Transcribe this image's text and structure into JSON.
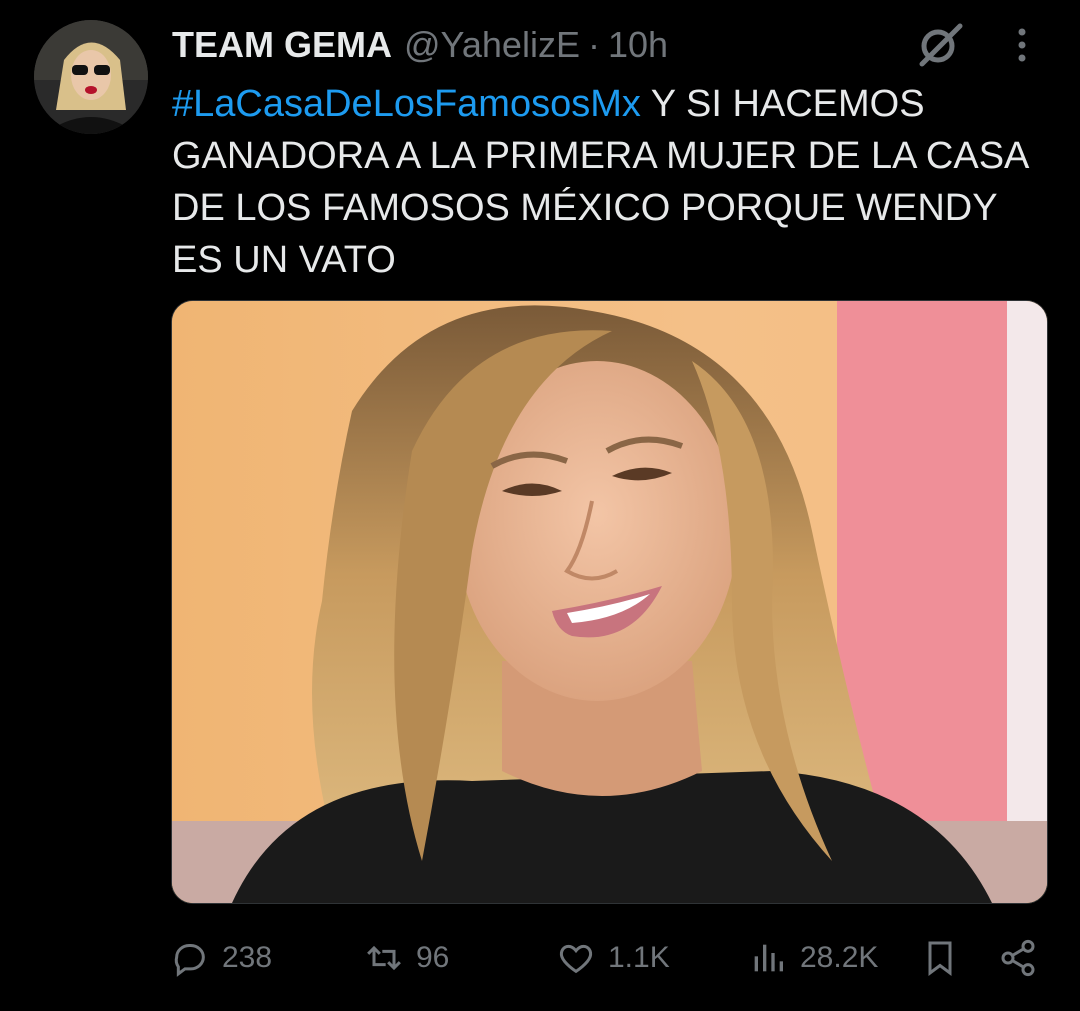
{
  "user": {
    "display_name": "TEAM GEMA",
    "handle": "@YahelizE",
    "separator": "·",
    "timestamp": "10h"
  },
  "header_icons": [
    "grok-icon",
    "more-options-icon"
  ],
  "tweet": {
    "hashtag": "#LaCasaDeLosFamososMx",
    "body": " Y SI HACEMOS GANADORA A LA PRIMERA MUJER DE LA CASA DE LOS FAMOSOS MÉXICO PORQUE WENDY ES UN VATO"
  },
  "media": {
    "icon": "photo"
  },
  "actions": {
    "replies": "238",
    "reposts": "96",
    "likes": "1.1K",
    "views": "28.2K",
    "icons": [
      "reply-icon",
      "repost-icon",
      "like-icon",
      "views-icon",
      "bookmark-icon",
      "share-icon"
    ]
  },
  "colors": {
    "background": "#000000",
    "text": "#e7e9ea",
    "muted": "#71767b",
    "link": "#1d9bf0"
  }
}
